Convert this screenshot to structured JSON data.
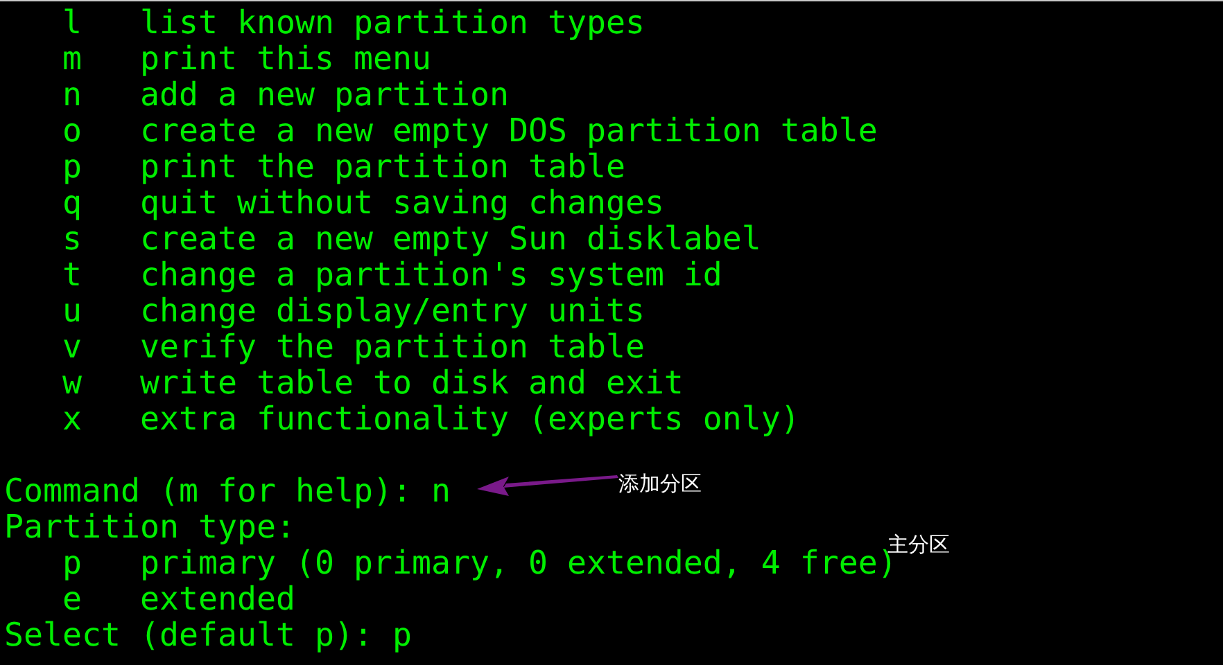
{
  "terminal": {
    "lines": [
      {
        "kind": "option",
        "key": "l",
        "text": "list known partition types"
      },
      {
        "kind": "option",
        "key": "m",
        "text": "print this menu"
      },
      {
        "kind": "option",
        "key": "n",
        "text": "add a new partition"
      },
      {
        "kind": "option",
        "key": "o",
        "text": "create a new empty DOS partition table"
      },
      {
        "kind": "option",
        "key": "p",
        "text": "print the partition table"
      },
      {
        "kind": "option",
        "key": "q",
        "text": "quit without saving changes"
      },
      {
        "kind": "option",
        "key": "s",
        "text": "create a new empty Sun disklabel"
      },
      {
        "kind": "option",
        "key": "t",
        "text": "change a partition's system id"
      },
      {
        "kind": "option",
        "key": "u",
        "text": "change display/entry units"
      },
      {
        "kind": "option",
        "key": "v",
        "text": "verify the partition table"
      },
      {
        "kind": "option",
        "key": "w",
        "text": "write table to disk and exit"
      },
      {
        "kind": "option",
        "key": "x",
        "text": "extra functionality (experts only)"
      },
      {
        "kind": "blank"
      },
      {
        "kind": "text",
        "text": "Command (m for help): n"
      },
      {
        "kind": "text",
        "text": "Partition type:"
      },
      {
        "kind": "option",
        "key": "p",
        "text": "primary (0 primary, 0 extended, 4 free)"
      },
      {
        "kind": "option",
        "key": "e",
        "text": "extended"
      },
      {
        "kind": "text",
        "text": "Select (default p): p"
      }
    ]
  },
  "annotations": [
    {
      "kind": "arrow-note",
      "text": "添加分区"
    },
    {
      "kind": "note",
      "text": "主分区"
    }
  ]
}
